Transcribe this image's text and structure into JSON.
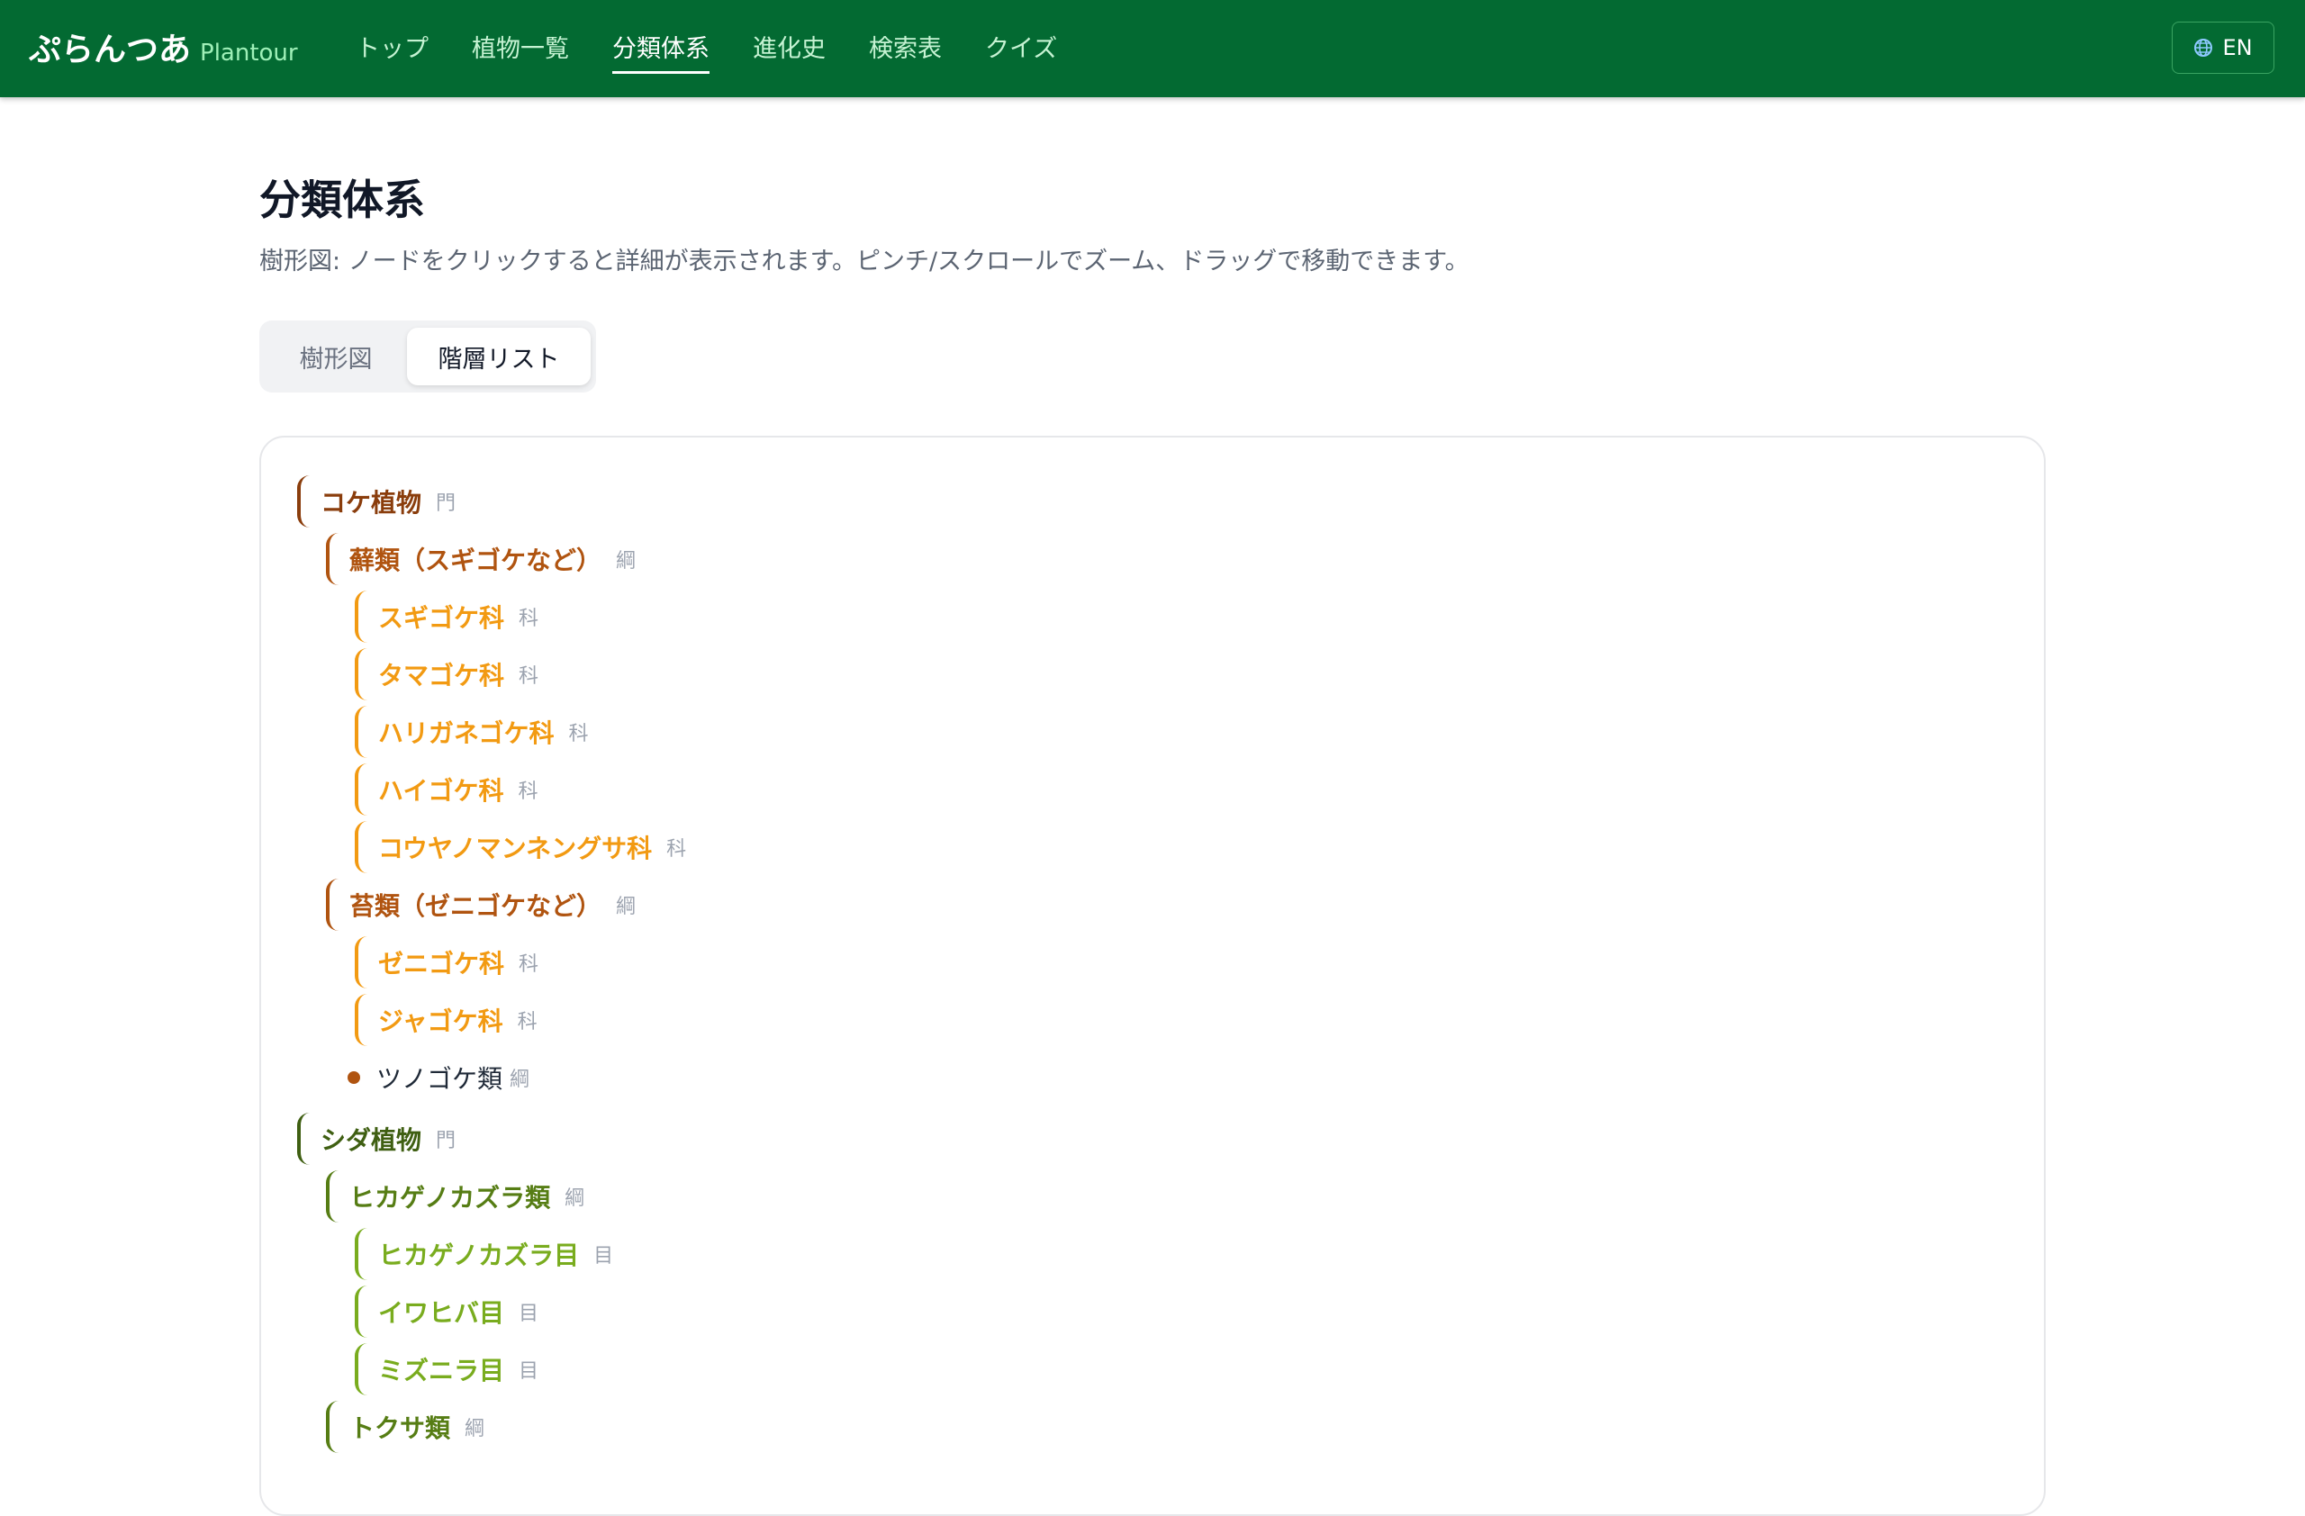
{
  "header": {
    "brand": "ぷらんつあ",
    "brand_sub": "Plantour",
    "nav": [
      "トップ",
      "植物一覧",
      "分類体系",
      "進化史",
      "検索表",
      "クイズ"
    ],
    "active_nav": "分類体系",
    "lang_label": "EN",
    "lang_icon": "globe-icon"
  },
  "main": {
    "title": "分類体系",
    "description": "樹形図: ノードをクリックすると詳細が表示されます。ピンチ/スクロールでズーム、ドラッグで移動できます。",
    "view_tabs": {
      "tree": "樹形図",
      "list": "階層リスト",
      "active": "階層リスト"
    }
  },
  "colors": {
    "header_bg": "#036a32",
    "moss_phylum": "#8a3d0c",
    "moss_class": "#b05410",
    "moss_family": "#f29a12",
    "fern_phylum": "#3f5f12",
    "fern_class": "#567d14",
    "fern_order": "#79ac1e"
  },
  "tree": [
    {
      "name": "コケ植物",
      "rank": "門"
    },
    {
      "name": "蘚類（スギゴケなど）",
      "rank": "綱"
    },
    {
      "name": "スギゴケ科",
      "rank": "科"
    },
    {
      "name": "タマゴケ科",
      "rank": "科"
    },
    {
      "name": "ハリガネゴケ科",
      "rank": "科"
    },
    {
      "name": "ハイゴケ科",
      "rank": "科"
    },
    {
      "name": "コウヤノマンネングサ科",
      "rank": "科"
    },
    {
      "name": "苔類（ゼニゴケなど）",
      "rank": "綱"
    },
    {
      "name": "ゼニゴケ科",
      "rank": "科"
    },
    {
      "name": "ジャゴケ科",
      "rank": "科"
    },
    {
      "name": "ツノゴケ類",
      "rank": "綱"
    },
    {
      "name": "シダ植物",
      "rank": "門"
    },
    {
      "name": "ヒカゲノカズラ類",
      "rank": "綱"
    },
    {
      "name": "ヒカゲノカズラ目",
      "rank": "目"
    },
    {
      "name": "イワヒバ目",
      "rank": "目"
    },
    {
      "name": "ミズニラ目",
      "rank": "目"
    },
    {
      "name": "トクサ類",
      "rank": "綱"
    }
  ]
}
